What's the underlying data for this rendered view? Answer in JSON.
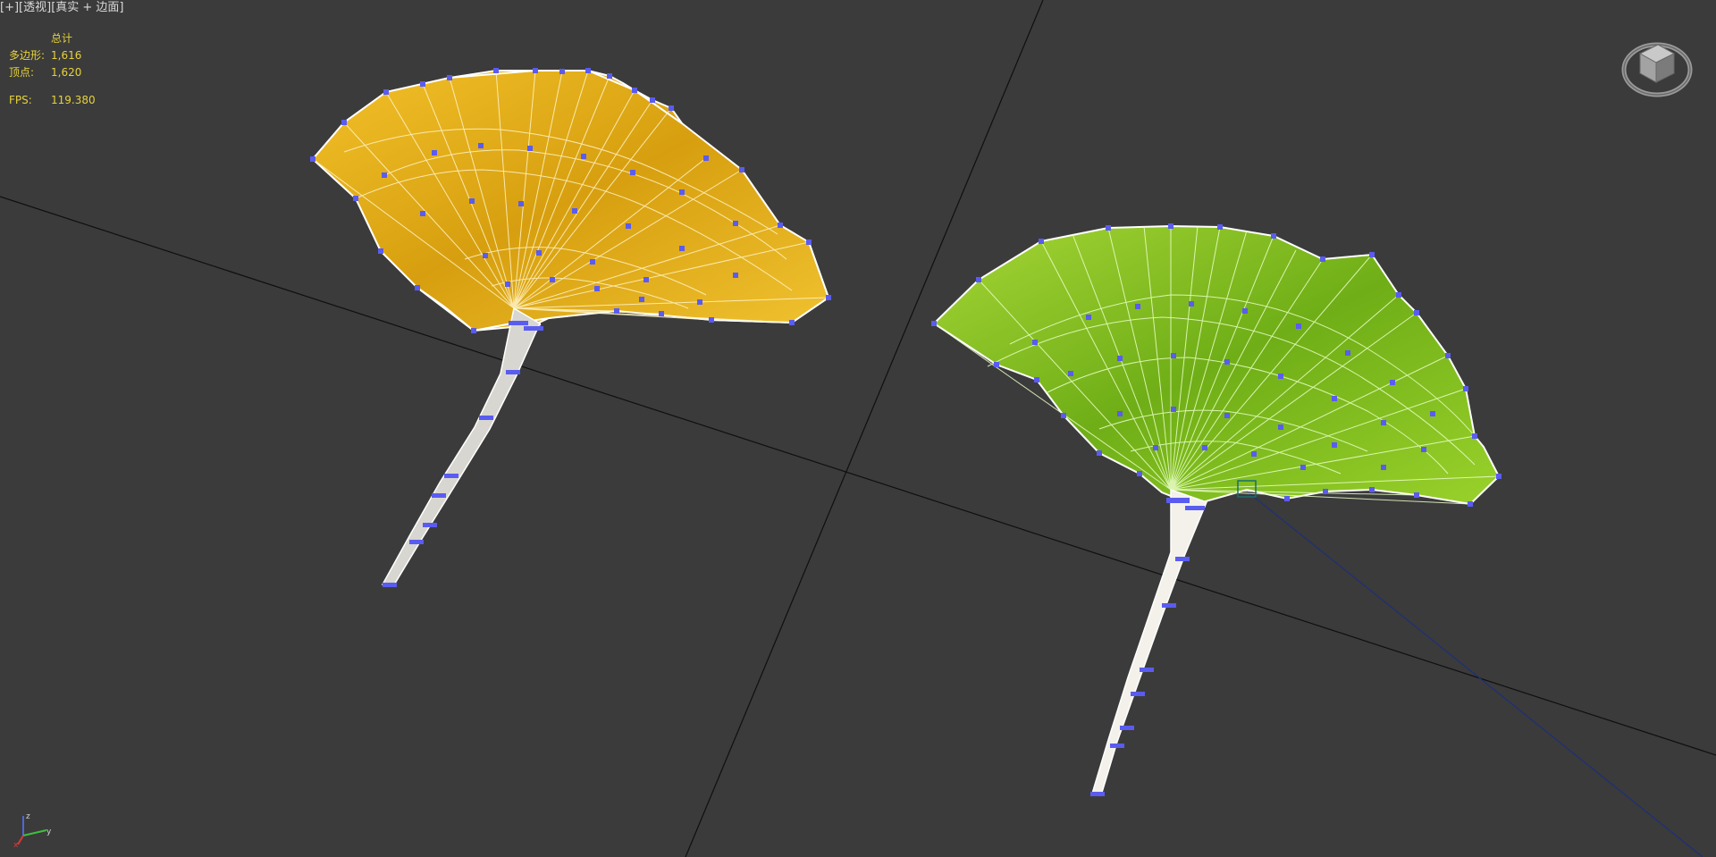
{
  "viewport": {
    "label_plus": "[+]",
    "label_view": "[透视]",
    "label_shading": "[真实 + 边面]"
  },
  "stats": {
    "header": "总计",
    "polygons_label": "多边形:",
    "polygons_value": "1,616",
    "vertices_label": "顶点:",
    "vertices_value": "1,620",
    "fps_label": "FPS:",
    "fps_value": "119.380"
  },
  "colors": {
    "background": "#3b3b3b",
    "grid_line": "#0f0f0f",
    "leaf_yellow": "#e8b417",
    "leaf_green": "#86c21e",
    "stem": "#d8d6d0",
    "vertex": "#5a5cf0",
    "stats_text": "#e6d23a"
  },
  "icons": {
    "viewcube": "viewcube-icon",
    "axis": "axis-tripod-icon"
  }
}
